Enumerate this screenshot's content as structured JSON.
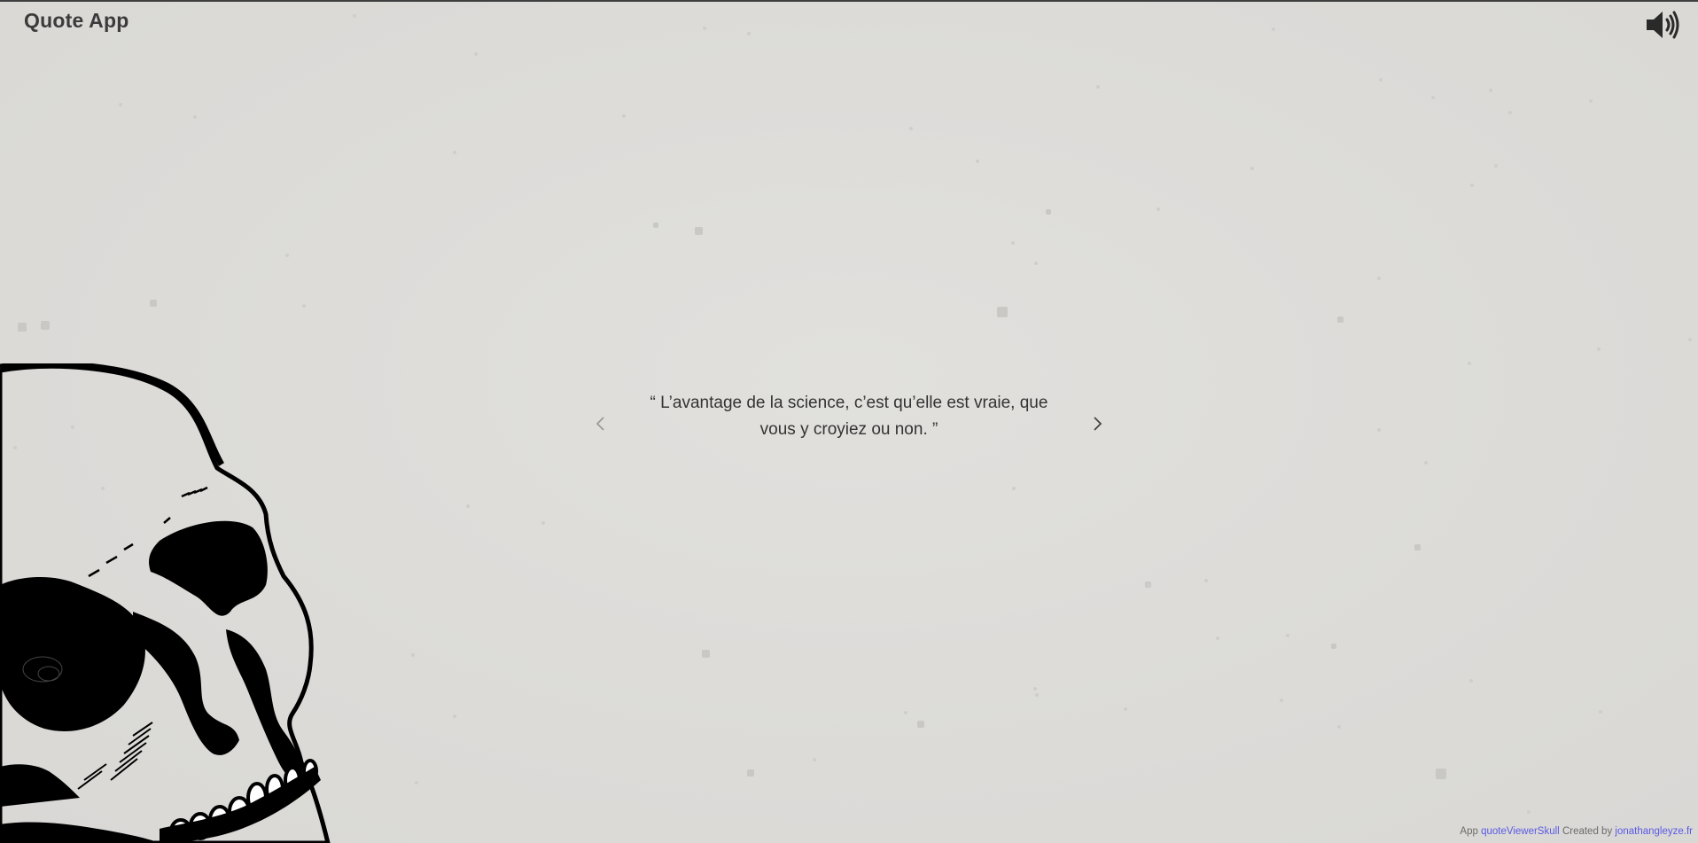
{
  "header": {
    "title": "Quote App",
    "sound_icon": "volume-up-icon"
  },
  "quote": {
    "open_mark": "“",
    "text": "L’avantage de la science, c’est qu’elle est vraie, que vous y croyiez ou non.",
    "close_mark": "”",
    "prev_icon": "chevron-left-icon",
    "next_icon": "chevron-right-icon"
  },
  "footer": {
    "app_prefix": "App",
    "app_link": "quoteViewerSkull",
    "created_by": "Created by",
    "author_link": "jonathangleyze.fr"
  },
  "colors": {
    "background": "#dddcd9",
    "text": "#333333",
    "link": "#5a5ae6",
    "skull": "#000000"
  }
}
